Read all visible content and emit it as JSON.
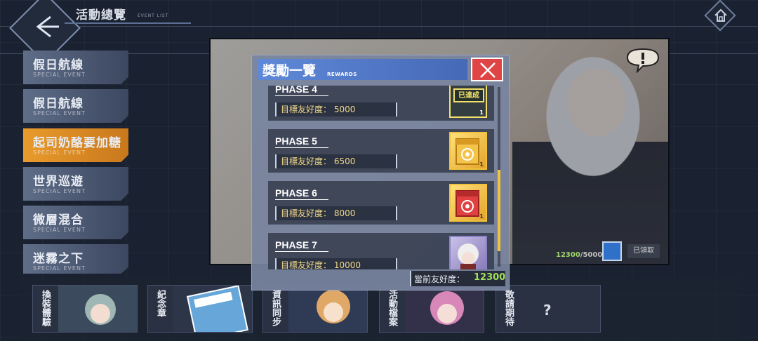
{
  "header": {
    "title": "活動總覽",
    "subtitle": "EVENT LIST"
  },
  "sidebar": {
    "items": [
      {
        "label": "假日航線",
        "sub": "SPECIAL EVENT",
        "active": false
      },
      {
        "label": "假日航線",
        "sub": "SPECIAL EVENT",
        "active": false
      },
      {
        "label": "起司奶酪要加糖",
        "sub": "SPECIAL EVENT",
        "active": true
      },
      {
        "label": "世界巡遊",
        "sub": "SPECIAL EVENT",
        "active": false
      },
      {
        "label": "微層混合",
        "sub": "SPECIAL EVENT",
        "active": false
      },
      {
        "label": "迷霧之下",
        "sub": "SPECIAL EVENT",
        "active": false
      }
    ]
  },
  "banner": {
    "current_value": "12300",
    "max_value": "/5000",
    "claimed_label": "已領取"
  },
  "dialog": {
    "title": "獎勵一覽",
    "title_sub": "REWARDS",
    "rows": [
      {
        "phase": "PHASE 4",
        "target": "目標友好度： 5000",
        "reward": "achieved",
        "reward_label": "已達成",
        "count": "1"
      },
      {
        "phase": "PHASE 5",
        "target": "目標友好度： 6500",
        "reward": "skill-yellow",
        "count": "1"
      },
      {
        "phase": "PHASE 6",
        "target": "目標友好度： 8000",
        "reward": "skill-red",
        "count": "1"
      },
      {
        "phase": "PHASE 7",
        "target": "目標友好度： 10000",
        "reward": "character",
        "count": ""
      }
    ],
    "affinity_label": "當前友好度：",
    "affinity_value": "12300"
  },
  "bottom_cards": [
    {
      "label": "換裝體驗"
    },
    {
      "label": "紀念章"
    },
    {
      "label": "資訊同步"
    },
    {
      "label": "活動檔案"
    },
    {
      "label": "敬請期待"
    }
  ],
  "bottom_unknown": "?",
  "colors": {
    "accent_orange": "#e89b2c",
    "dialog_blue": "#4d74c4",
    "close_red": "#e04545",
    "affinity_green": "#9fe05b",
    "target_text": "#f1d88a"
  }
}
